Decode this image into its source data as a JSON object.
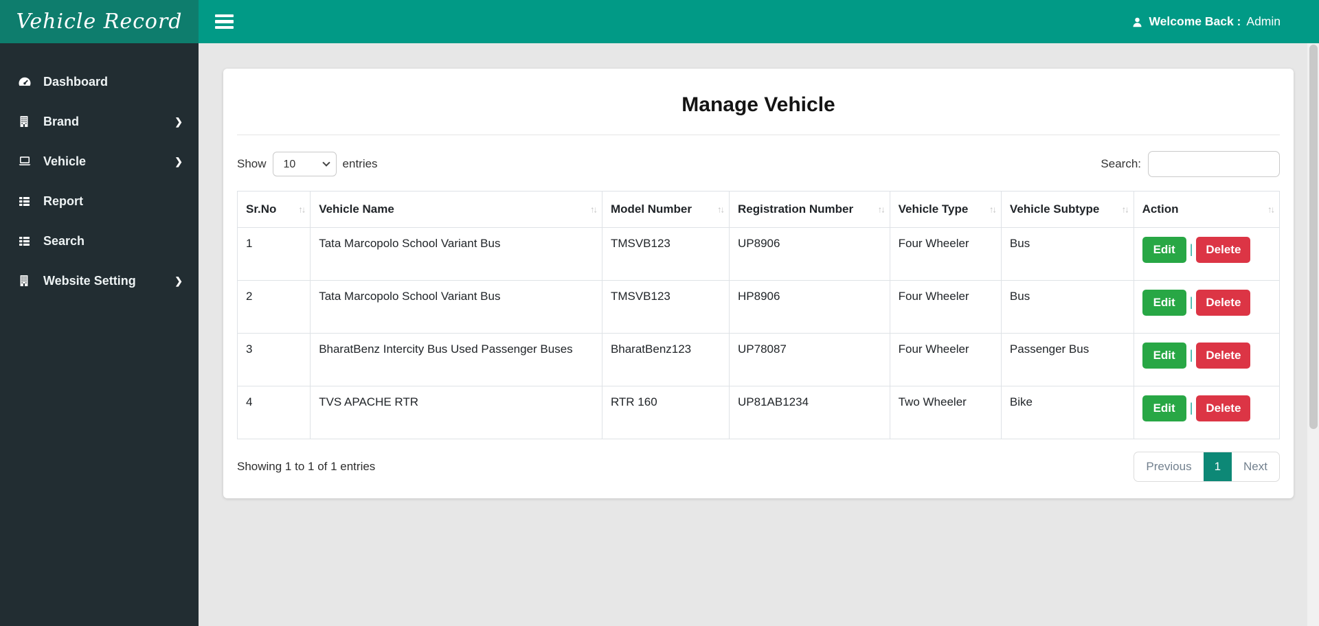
{
  "colors": {
    "header_teal": "#019a86",
    "logo_teal": "#0e7d6d",
    "sidebar_dark": "#222d32",
    "page_background": "#e7e7e7",
    "active_page_teal": "#0d8876",
    "edit_green": "#28a745",
    "delete_red": "#dc3545"
  },
  "header": {
    "logo_text": "Vehicle Record",
    "welcome_prefix": "Welcome Back :",
    "welcome_user": "Admin"
  },
  "sidebar": {
    "items": [
      {
        "label": "Dashboard",
        "icon": "dashboard-gauge-icon",
        "has_submenu": false
      },
      {
        "label": "Brand",
        "icon": "building-icon",
        "has_submenu": true
      },
      {
        "label": "Vehicle",
        "icon": "laptop-icon",
        "has_submenu": true
      },
      {
        "label": "Report",
        "icon": "list-icon",
        "has_submenu": false
      },
      {
        "label": "Search",
        "icon": "list-icon",
        "has_submenu": false
      },
      {
        "label": "Website Setting",
        "icon": "building-icon",
        "has_submenu": true
      }
    ]
  },
  "main": {
    "title": "Manage Vehicle",
    "length_control": {
      "show_label": "Show",
      "selected_value": "10",
      "entries_label": "entries"
    },
    "search": {
      "label": "Search:",
      "value": ""
    },
    "table": {
      "columns": [
        "Sr.No",
        "Vehicle Name",
        "Model Number",
        "Registration Number",
        "Vehicle Type",
        "Vehicle Subtype",
        "Action"
      ],
      "rows": [
        {
          "cells": [
            "1",
            "Tata Marcopolo School Variant Bus",
            "TMSVB123",
            "UP8906",
            "Four Wheeler",
            "Bus"
          ]
        },
        {
          "cells": [
            "2",
            "Tata Marcopolo School Variant Bus",
            "TMSVB123",
            "HP8906",
            "Four Wheeler",
            "Bus"
          ]
        },
        {
          "cells": [
            "3",
            "BharatBenz Intercity Bus Used Passenger Buses",
            "BharatBenz123",
            "UP78087",
            "Four Wheeler",
            "Passenger Bus"
          ]
        },
        {
          "cells": [
            "4",
            "TVS APACHE RTR",
            "RTR 160",
            "UP81AB1234",
            "Two Wheeler",
            "Bike"
          ]
        }
      ],
      "action_edit": "Edit",
      "action_delete": "Delete",
      "action_separator": "|"
    },
    "footer": {
      "info": "Showing 1 to 1 of 1 entries",
      "pagination": {
        "previous": "Previous",
        "pages": [
          "1"
        ],
        "active": "1",
        "next": "Next"
      }
    }
  },
  "icons": {
    "sort": "↑↓",
    "chevron_right": "❯"
  }
}
